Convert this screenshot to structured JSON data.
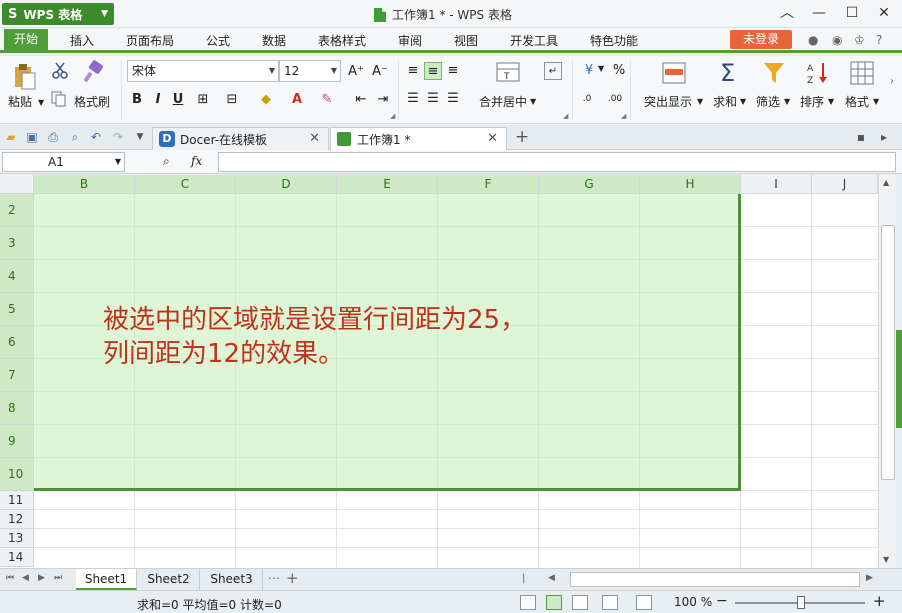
{
  "app": {
    "logo": "S",
    "name": "WPS 表格"
  },
  "window": {
    "title": "工作簿1 * - WPS 表格"
  },
  "menu": {
    "tabs": [
      "开始",
      "插入",
      "页面布局",
      "公式",
      "数据",
      "表格样式",
      "审阅",
      "视图",
      "开发工具",
      "特色功能"
    ],
    "login": "未登录",
    "help": "?"
  },
  "ribbon": {
    "paste": "粘贴",
    "format_painter": "格式刷",
    "font_name": "宋体",
    "font_size": "12",
    "merge_center": "合并居中",
    "conditional_format": "突出显示",
    "sum": "求和",
    "filter": "筛选",
    "sort": "排序",
    "format": "格式"
  },
  "tabs": [
    {
      "label": "Docer-在线模板"
    },
    {
      "label": "工作簿1 *"
    }
  ],
  "formula_bar": {
    "cell_ref": "A1",
    "fx": "fx",
    "value": ""
  },
  "columns": [
    "B",
    "C",
    "D",
    "E",
    "F",
    "G",
    "H",
    "I",
    "J"
  ],
  "rows": [
    "2",
    "3",
    "4",
    "5",
    "6",
    "7",
    "8",
    "9",
    "10",
    "11",
    "12",
    "13",
    "14"
  ],
  "annotation": {
    "line1": "被选中的区域就是设置行间距为25，",
    "line2": "列间距为12的效果。"
  },
  "sheets": [
    "Sheet1",
    "Sheet2",
    "Sheet3"
  ],
  "status": {
    "summary": "求和=0  平均值=0  计数=0",
    "zoom": "100 %"
  },
  "colors": {
    "accent": "#4f9e3a",
    "selection": "#cfe8c5",
    "annotation": "#c0321b",
    "login": "#e9633b"
  }
}
